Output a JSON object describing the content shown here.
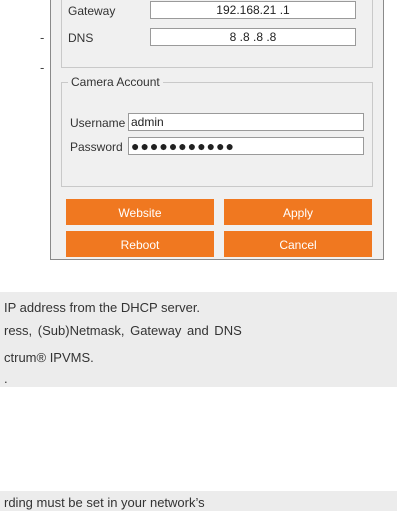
{
  "left_fragments": [
    "-",
    "-"
  ],
  "network": {
    "gateway_label": "Gateway",
    "gateway_value": "192.168.21 .1",
    "dns_label": "DNS",
    "dns_value": "8  .8  .8  .8"
  },
  "camera_account": {
    "legend": "Camera Account",
    "username_label": "Username",
    "username_value": "admin",
    "password_label": "Password",
    "password_value": "●●●●●●●●●●●"
  },
  "buttons": {
    "website": "Website",
    "apply": "Apply",
    "reboot": "Reboot",
    "cancel": "Cancel"
  },
  "notes": {
    "line1": "IP address from the DHCP server.",
    "line2": "ress,  (Sub)Netmask,  Gateway  and  DNS",
    "line3": "ctrum® IPVMS.",
    "line4": ".",
    "line5": "rding must be set in your network’s"
  }
}
